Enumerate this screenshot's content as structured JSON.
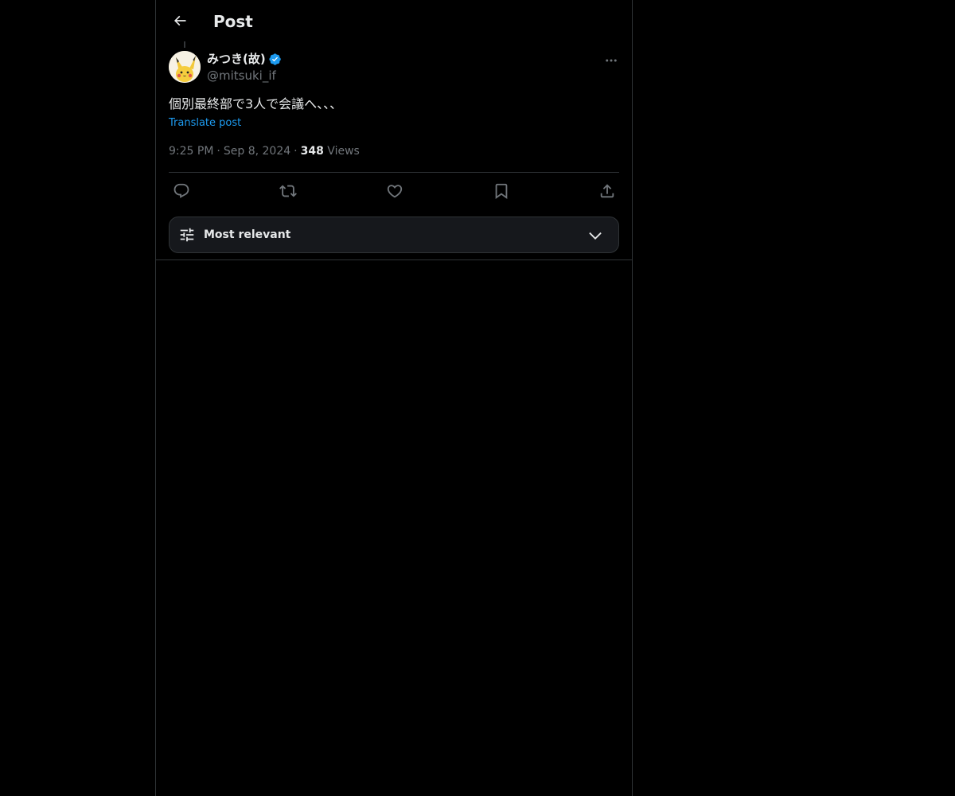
{
  "header": {
    "title": "Post",
    "back_icon": "arrow-left-icon"
  },
  "post": {
    "author": {
      "name": "みつき(故)",
      "handle": "@mitsuki_if",
      "verified": true,
      "avatar": "pikachu-avatar"
    },
    "text": "個別最終部で3人で会議へ、、、",
    "translate_label": "Translate post",
    "time": "9:25 PM",
    "date": "Sep 8, 2024",
    "views_count": "348",
    "views_label": "Views"
  },
  "actions": [
    {
      "name": "reply",
      "icon": "reply-icon"
    },
    {
      "name": "repost",
      "icon": "repost-icon"
    },
    {
      "name": "like",
      "icon": "heart-icon"
    },
    {
      "name": "bookmark",
      "icon": "bookmark-icon"
    },
    {
      "name": "share",
      "icon": "share-icon"
    }
  ],
  "replies_sort": {
    "label": "Most relevant",
    "icon": "sliders-icon",
    "chevron": "chevron-down-icon"
  },
  "colors": {
    "background": "#000000",
    "text": "#e7e9ea",
    "secondary_text": "#71767b",
    "accent": "#1d9bf0",
    "border": "#2f3336"
  }
}
